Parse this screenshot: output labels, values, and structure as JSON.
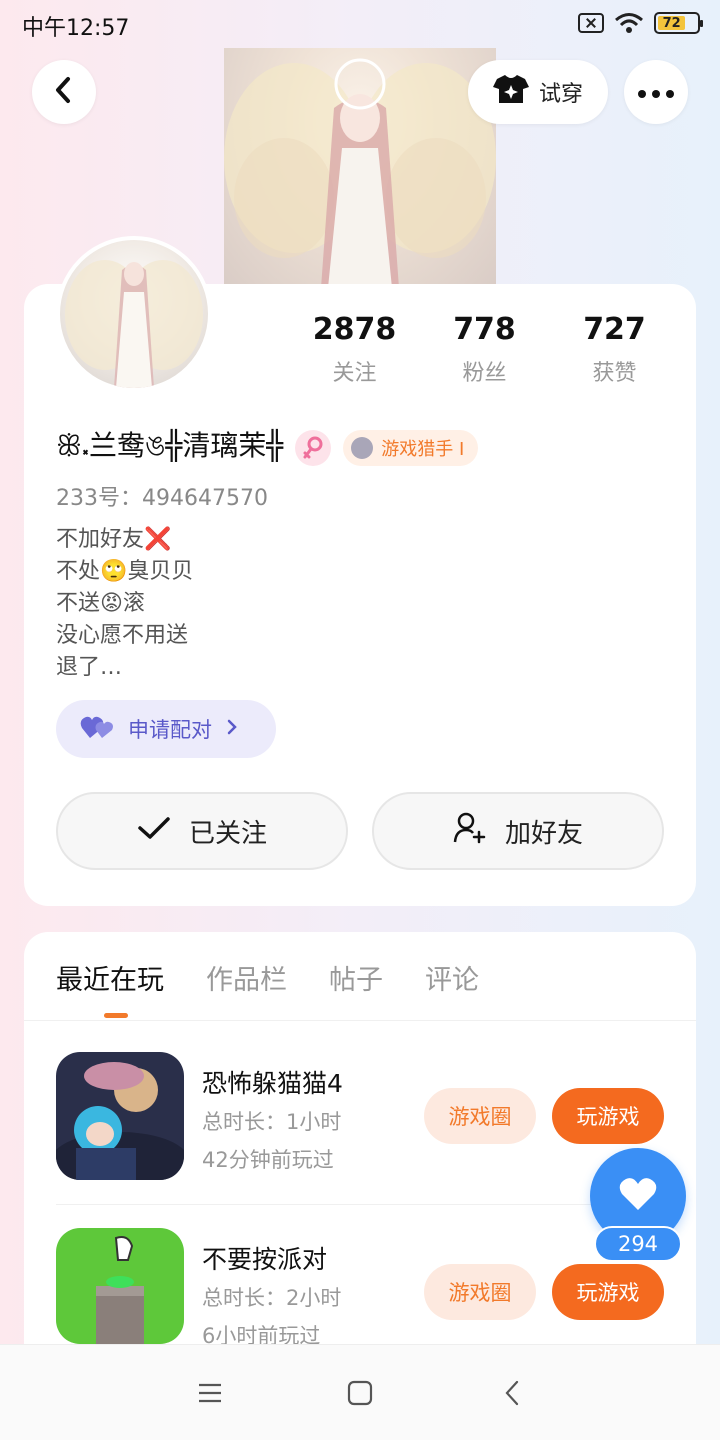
{
  "status_bar": {
    "time": "中午12:57",
    "battery_level": "72",
    "icons": [
      "sim-off-icon",
      "wifi-icon",
      "battery-icon"
    ]
  },
  "header": {
    "back_icon": "chevron-left-icon",
    "tryon_label": "试穿",
    "tryon_icon": "tshirt-sparkle-icon",
    "more_icon": "more-dots-icon"
  },
  "profile": {
    "stats": [
      {
        "value": "2878",
        "label": "关注"
      },
      {
        "value": "778",
        "label": "粉丝"
      },
      {
        "value": "727",
        "label": "获赞"
      }
    ],
    "username": "ꕥ⸼兰鸯ঙ╬清璃茉╬",
    "gender_icon": "female-icon",
    "tag": "游戏猎手 I",
    "uid": "233号：494647570",
    "bio": [
      "不加好友❌",
      "不处🙄臭贝贝",
      "不送😡滚",
      "没心愿不用送",
      "退了…"
    ],
    "match_label": "申请配对",
    "follow_label": "已关注",
    "add_friend_label": "加好友"
  },
  "tabs": [
    "最近在玩",
    "作品栏",
    "帖子",
    "评论"
  ],
  "games": [
    {
      "title": "恐怖躲猫猫4",
      "duration": "总时长：1小时",
      "last_played": "42分钟前玩过",
      "circle_label": "游戏圈",
      "play_label": "玩游戏"
    },
    {
      "title": "不要按派对",
      "duration": "总时长：2小时",
      "last_played": "6小时前玩过",
      "circle_label": "游戏圈",
      "play_label": "玩游戏"
    }
  ],
  "like": {
    "count": "294",
    "icon": "heart-icon"
  },
  "nav": {
    "icons": [
      "menu-icon",
      "home-square-icon",
      "back-triangle-icon"
    ]
  },
  "colors": {
    "accent": "#f46a1f",
    "like_blue": "#3a8ff5",
    "match_purple": "#5a59c9"
  }
}
